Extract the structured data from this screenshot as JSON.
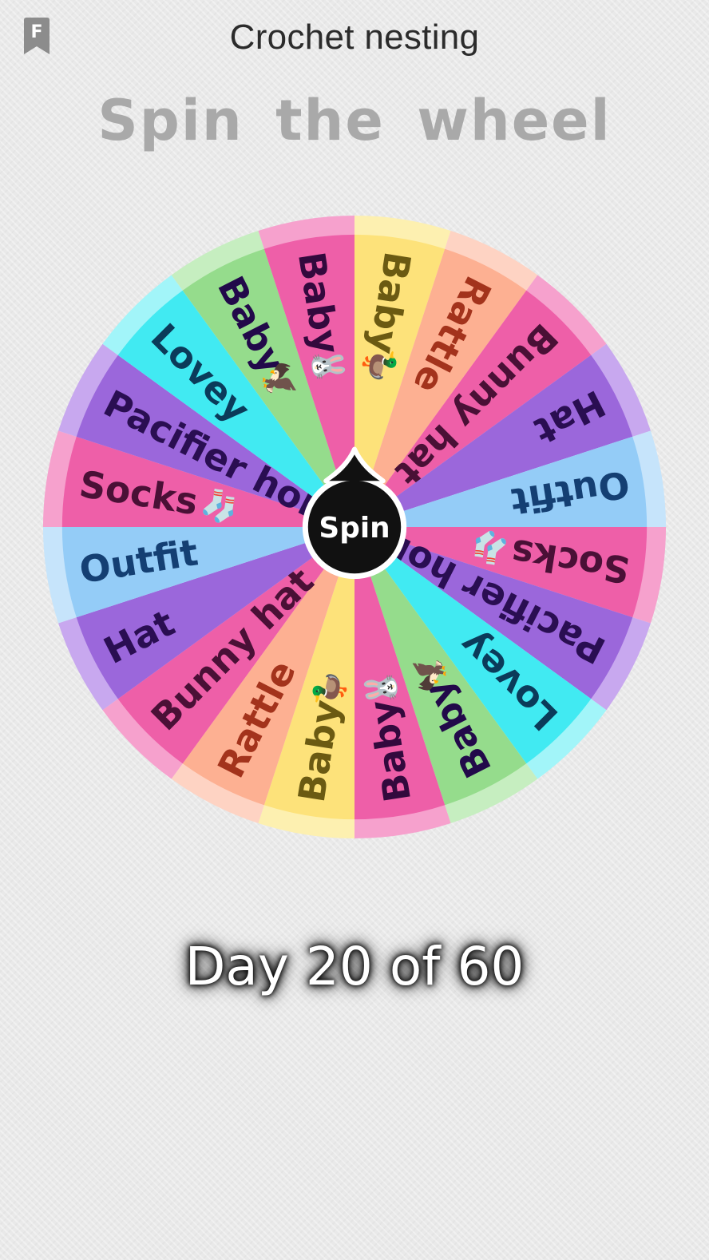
{
  "header": {
    "title": "Crochet nesting",
    "bookmark_icon": "bookmark-f-icon",
    "bookmark_letter": "F"
  },
  "heading": "Spin the wheel",
  "wheel": {
    "spin_label": "Spin",
    "segments": [
      {
        "label": "Baby",
        "emoji": "🦆",
        "color": "#fde27a",
        "rim": "#fdf0b0",
        "text_color": "#6b5a12"
      },
      {
        "label": "Rattle",
        "emoji": "",
        "color": "#fdb092",
        "rim": "#fed3c3",
        "text_color": "#a3331c"
      },
      {
        "label": "Bunny hat",
        "emoji": "",
        "color": "#ee5fa8",
        "rim": "#f6a1cd",
        "text_color": "#4a1036"
      },
      {
        "label": "Hat",
        "emoji": "",
        "color": "#9b67db",
        "rim": "#c8a8ef",
        "text_color": "#2a0e52"
      },
      {
        "label": "Outfit",
        "emoji": "",
        "color": "#94ccf7",
        "rim": "#c6e4fb",
        "text_color": "#143f73"
      },
      {
        "label": "Socks",
        "emoji": "🧦",
        "color": "#ee5fa8",
        "rim": "#f6a1cd",
        "text_color": "#4a1036"
      },
      {
        "label": "Pacifier hol",
        "emoji": "",
        "color": "#9b67db",
        "rim": "#c8a8ef",
        "text_color": "#2a0e52"
      },
      {
        "label": "Lovey",
        "emoji": "",
        "color": "#41eaf2",
        "rim": "#a2f5f9",
        "text_color": "#0b3b5a"
      },
      {
        "label": "Baby",
        "emoji": "🦅",
        "color": "#95dc8c",
        "rim": "#c6eec0",
        "text_color": "#22094a"
      },
      {
        "label": "Baby",
        "emoji": "🐰",
        "color": "#ee5fa8",
        "rim": "#f6a1cd",
        "text_color": "#33093d"
      },
      {
        "label": "Baby",
        "emoji": "🦆",
        "color": "#fde27a",
        "rim": "#fdf0b0",
        "text_color": "#6b5a12"
      },
      {
        "label": "Rattle",
        "emoji": "",
        "color": "#fdb092",
        "rim": "#fed3c3",
        "text_color": "#a3331c"
      },
      {
        "label": "Bunny hat",
        "emoji": "",
        "color": "#ee5fa8",
        "rim": "#f6a1cd",
        "text_color": "#4a1036"
      },
      {
        "label": "Hat",
        "emoji": "",
        "color": "#9b67db",
        "rim": "#c8a8ef",
        "text_color": "#2a0e52"
      },
      {
        "label": "Outfit",
        "emoji": "",
        "color": "#94ccf7",
        "rim": "#c6e4fb",
        "text_color": "#143f73"
      },
      {
        "label": "Socks",
        "emoji": "🧦",
        "color": "#ee5fa8",
        "rim": "#f6a1cd",
        "text_color": "#4a1036"
      },
      {
        "label": "Pacifier hol",
        "emoji": "",
        "color": "#9b67db",
        "rim": "#c8a8ef",
        "text_color": "#2a0e52"
      },
      {
        "label": "Lovey",
        "emoji": "",
        "color": "#41eaf2",
        "rim": "#a2f5f9",
        "text_color": "#0b3b5a"
      },
      {
        "label": "Baby",
        "emoji": "🦅",
        "color": "#95dc8c",
        "rim": "#c6eec0",
        "text_color": "#22094a"
      },
      {
        "label": "Baby",
        "emoji": "🐰",
        "color": "#ee5fa8",
        "rim": "#f6a1cd",
        "text_color": "#33093d"
      }
    ]
  },
  "progress": {
    "text": "Day 20 of 60",
    "current": 20,
    "total": 60
  }
}
